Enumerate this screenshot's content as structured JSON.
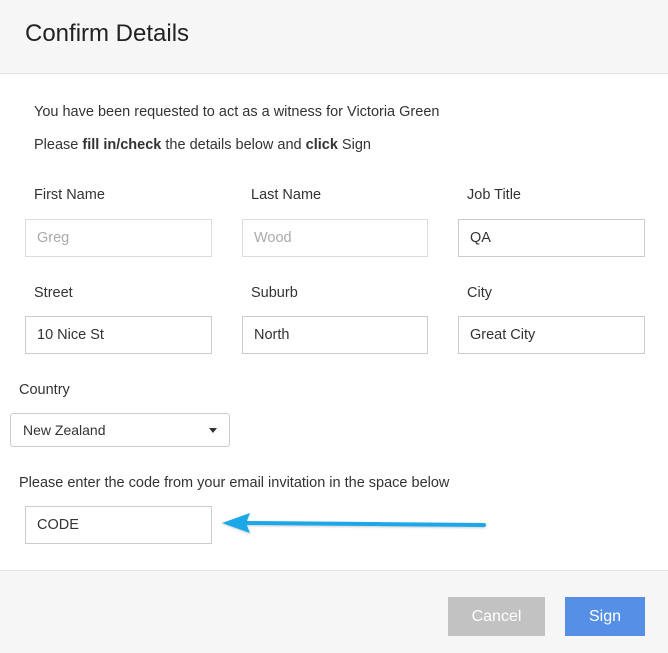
{
  "dialog": {
    "title": "Confirm Details"
  },
  "intro": {
    "line1": "You have been requested to act as a witness for Victoria Green",
    "line2_pre": "Please ",
    "line2_bold1": "fill in/check",
    "line2_mid": " the details below and ",
    "line2_bold2": "click",
    "line2_post": " Sign"
  },
  "fields": {
    "first_name": {
      "label": "First Name",
      "value": "Greg"
    },
    "last_name": {
      "label": "Last Name",
      "value": "Wood"
    },
    "job_title": {
      "label": "Job Title",
      "value": "QA"
    },
    "street": {
      "label": "Street",
      "value": "10 Nice St"
    },
    "suburb": {
      "label": "Suburb",
      "value": "North"
    },
    "city": {
      "label": "City",
      "value": "Great City"
    },
    "country": {
      "label": "Country",
      "value": "New Zealand"
    },
    "code": {
      "instruction": "Please enter the code from your email invitation in the space below",
      "value": "CODE"
    }
  },
  "buttons": {
    "cancel": "Cancel",
    "sign": "Sign"
  },
  "colors": {
    "sign_button": "#5590e6",
    "cancel_button": "#c2c2c2",
    "arrow": "#1aa7e8"
  }
}
